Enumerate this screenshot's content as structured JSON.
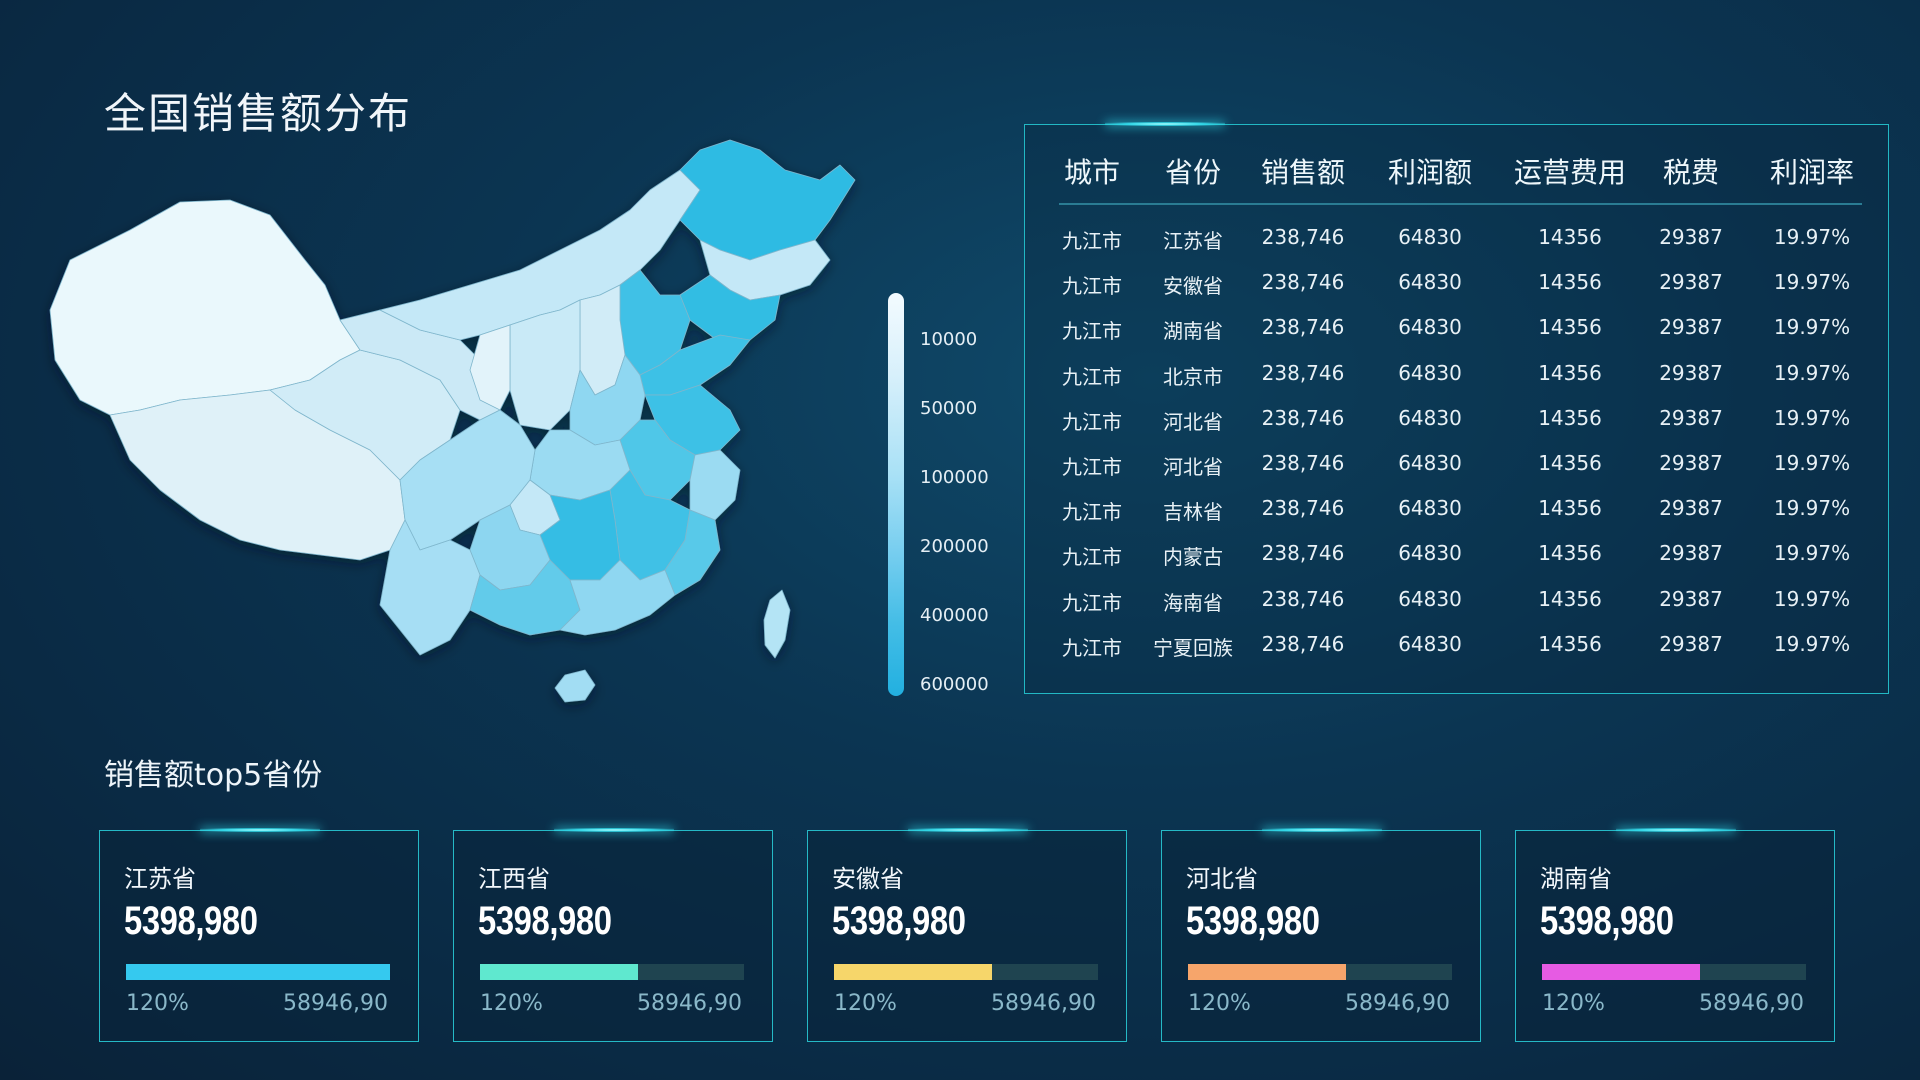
{
  "page_title": "全国销售额分布",
  "legend": {
    "labels": [
      "10000",
      "50000",
      "100000",
      "200000",
      "400000",
      "600000"
    ]
  },
  "table": {
    "headers": [
      "城市",
      "省份",
      "销售额",
      "利润额",
      "运营费用",
      "税费",
      "利润率"
    ],
    "rows": [
      [
        "九江市",
        "江苏省",
        "238,746",
        "64830",
        "14356",
        "29387",
        "19.97%"
      ],
      [
        "九江市",
        "安徽省",
        "238,746",
        "64830",
        "14356",
        "29387",
        "19.97%"
      ],
      [
        "九江市",
        "湖南省",
        "238,746",
        "64830",
        "14356",
        "29387",
        "19.97%"
      ],
      [
        "九江市",
        "北京市",
        "238,746",
        "64830",
        "14356",
        "29387",
        "19.97%"
      ],
      [
        "九江市",
        "河北省",
        "238,746",
        "64830",
        "14356",
        "29387",
        "19.97%"
      ],
      [
        "九江市",
        "河北省",
        "238,746",
        "64830",
        "14356",
        "29387",
        "19.97%"
      ],
      [
        "九江市",
        "吉林省",
        "238,746",
        "64830",
        "14356",
        "29387",
        "19.97%"
      ],
      [
        "九江市",
        "内蒙古",
        "238,746",
        "64830",
        "14356",
        "29387",
        "19.97%"
      ],
      [
        "九江市",
        "海南省",
        "238,746",
        "64830",
        "14356",
        "29387",
        "19.97%"
      ],
      [
        "九江市",
        "宁夏回族",
        "238,746",
        "64830",
        "14356",
        "29387",
        "19.97%"
      ]
    ]
  },
  "top5": {
    "title": "销售额top5省份",
    "cards": [
      {
        "name": "江苏省",
        "value": "5398,980",
        "percent": "120%",
        "amount": "58946,90",
        "progress": 1.0,
        "color": "#35c9ef"
      },
      {
        "name": "江西省",
        "value": "5398,980",
        "percent": "120%",
        "amount": "58946,90",
        "progress": 0.6,
        "color": "#5fe8cf"
      },
      {
        "name": "安徽省",
        "value": "5398,980",
        "percent": "120%",
        "amount": "58946,90",
        "progress": 0.6,
        "color": "#f6d66a"
      },
      {
        "name": "河北省",
        "value": "5398,980",
        "percent": "120%",
        "amount": "58946,90",
        "progress": 0.6,
        "color": "#f6a56b"
      },
      {
        "name": "湖南省",
        "value": "5398,980",
        "percent": "120%",
        "amount": "58946,90",
        "progress": 0.6,
        "color": "#e65be3"
      }
    ]
  }
}
